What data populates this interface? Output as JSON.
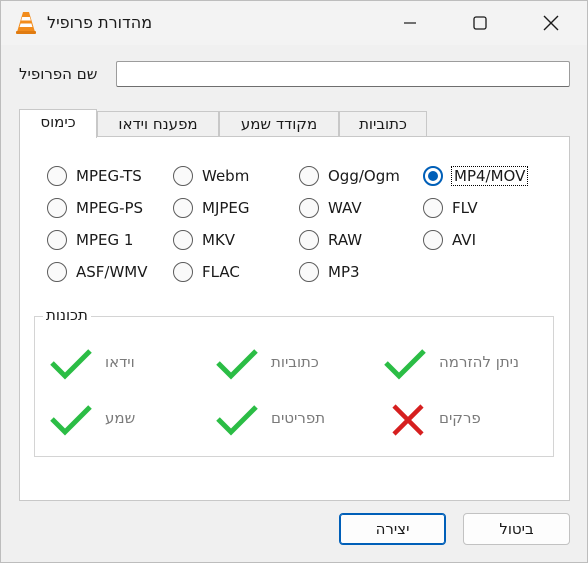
{
  "window": {
    "title": "מהדורת פרופיל"
  },
  "profile": {
    "label": "שם הפרופיל",
    "value": "",
    "placeholder": ""
  },
  "tabs": [
    {
      "label": "כימוס",
      "active": true
    },
    {
      "label": "מפענח וידאו",
      "active": false
    },
    {
      "label": "מקודד שמע",
      "active": false
    },
    {
      "label": "כתוביות",
      "active": false
    }
  ],
  "formats": [
    {
      "label": "MPEG-TS",
      "checked": false
    },
    {
      "label": "Webm",
      "checked": false
    },
    {
      "label": "Ogg/Ogm",
      "checked": false
    },
    {
      "label": "MP4/MOV",
      "checked": true
    },
    {
      "label": "MPEG-PS",
      "checked": false
    },
    {
      "label": "MJPEG",
      "checked": false
    },
    {
      "label": "WAV",
      "checked": false
    },
    {
      "label": "FLV",
      "checked": false
    },
    {
      "label": "MPEG 1",
      "checked": false
    },
    {
      "label": "MKV",
      "checked": false
    },
    {
      "label": "RAW",
      "checked": false
    },
    {
      "label": "AVI",
      "checked": false
    },
    {
      "label": "ASF/WMV",
      "checked": false
    },
    {
      "label": "FLAC",
      "checked": false
    },
    {
      "label": "MP3",
      "checked": false
    }
  ],
  "features": {
    "title": "תכונות",
    "items": [
      {
        "label": "וידאו",
        "supported": true
      },
      {
        "label": "כתוביות",
        "supported": true
      },
      {
        "label": "ניתן להזרמה",
        "supported": true
      },
      {
        "label": "שמע",
        "supported": true
      },
      {
        "label": "תפריטים",
        "supported": true
      },
      {
        "label": "פרקים",
        "supported": false
      }
    ]
  },
  "buttons": {
    "create": "יצירה",
    "cancel": "ביטול"
  },
  "colors": {
    "accent": "#005fb8",
    "check": "#2bbd45",
    "cross": "#d61f1f"
  }
}
